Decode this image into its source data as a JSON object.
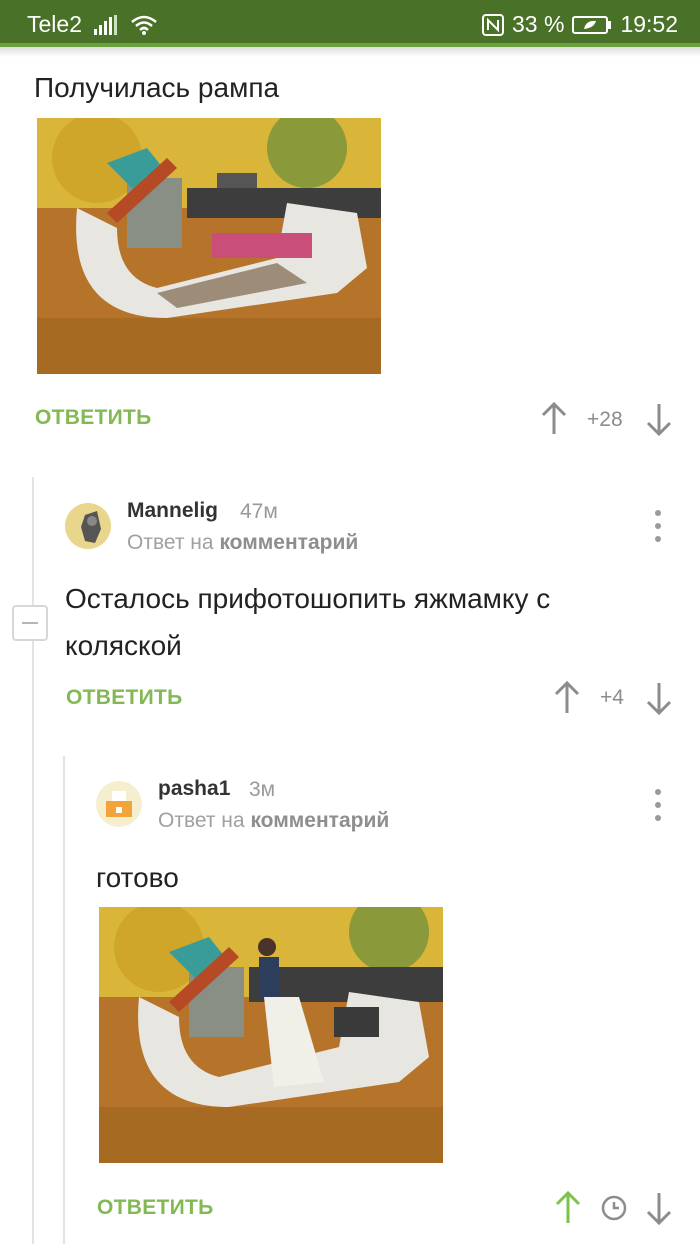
{
  "statusbar": {
    "carrier": "Tele2",
    "battery_percent": "33 %",
    "time": "19:52",
    "color": "#4a7128"
  },
  "post": {
    "caption": "Получилась рампа",
    "reply_label": "ОТВЕТИТЬ",
    "score": "+28"
  },
  "comments": [
    {
      "author": "Mannelig",
      "time": "47м",
      "reply_to_prefix": "Ответ на",
      "reply_to_link": "комментарий",
      "text": "Осталось прифотошопить яжмамку с коляской",
      "reply_label": "ОТВЕТИТЬ",
      "score": "+4"
    },
    {
      "author": "pasha1",
      "time": "3м",
      "reply_to_prefix": "Ответ на",
      "reply_to_link": "комментарий",
      "text": "готово",
      "reply_label": "ОТВЕТИТЬ"
    }
  ],
  "colors": {
    "accent": "#83b954",
    "upvoted": "#7cc24d"
  }
}
